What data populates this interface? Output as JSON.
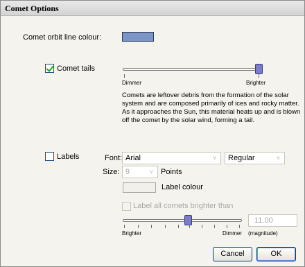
{
  "window": {
    "title": "Comet Options"
  },
  "orbit": {
    "label": "Comet orbit line colour:",
    "swatch_color": "#7b95c7"
  },
  "tails": {
    "checkbox_label": "Comet tails",
    "checked": true,
    "slider_min_label": "Dimmer",
    "slider_max_label": "Brighter",
    "slider_value_fraction": 1.0,
    "description": [
      "Comets are leftover debris from the formation of the solar",
      "system and are composed primarily of ices and rocky matter.",
      "As it approaches the Sun, this material heats up and is blown",
      "off the comet by the solar wind, forming a tail."
    ]
  },
  "labels": {
    "checkbox_label": "Labels",
    "checked": false,
    "font_label": "Font:",
    "font_value": "Arial",
    "style_value": "Regular",
    "size_label": "Size:",
    "size_value": "9",
    "size_unit": "Points",
    "label_colour_text": "Label colour",
    "label_all_text": "Label all comets brighter than",
    "magnitude_min_label": "Brighter",
    "magnitude_max_label": "Dimmer",
    "magnitude_unit": "(magnitude)",
    "magnitude_value": "11.00",
    "slider_value_fraction": 0.5
  },
  "buttons": {
    "cancel": "Cancel",
    "ok": "OK"
  },
  "icons": {
    "dropdown": "chevron-down-icon",
    "checkmark": "check-icon"
  }
}
